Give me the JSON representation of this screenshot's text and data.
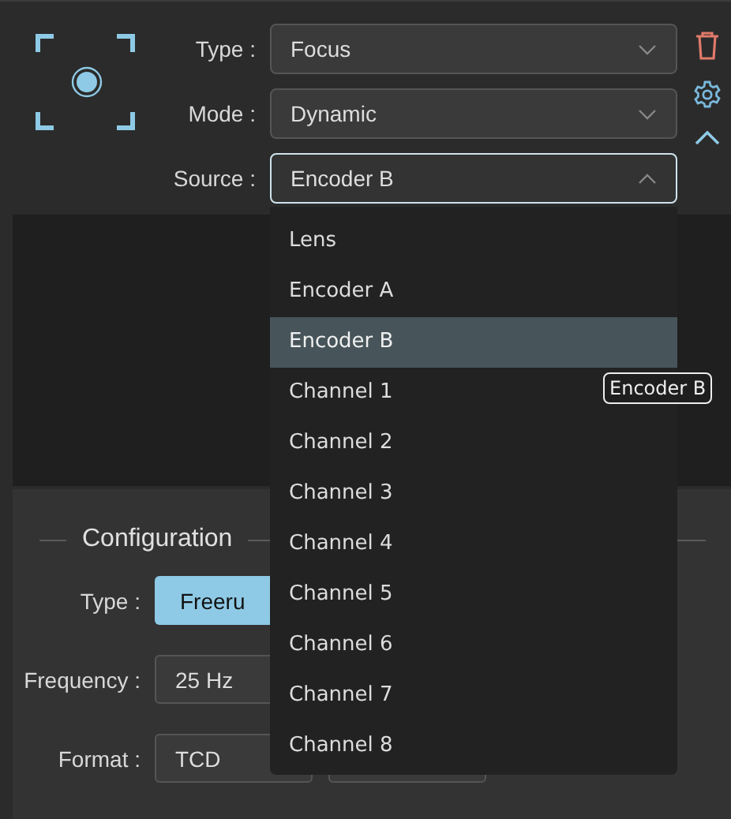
{
  "selectors": [
    {
      "label": "Type :",
      "value": "Focus",
      "open": false
    },
    {
      "label": "Mode :",
      "value": "Dynamic",
      "open": false
    },
    {
      "label": "Source :",
      "value": "Encoder B",
      "open": true
    }
  ],
  "dropdown": {
    "options": [
      {
        "label": "Lens",
        "selected": false
      },
      {
        "label": "Encoder A",
        "selected": false
      },
      {
        "label": "Encoder B",
        "selected": true
      },
      {
        "label": "Channel 1",
        "selected": false
      },
      {
        "label": "Channel 2",
        "selected": false
      },
      {
        "label": "Channel 3",
        "selected": false
      },
      {
        "label": "Channel 4",
        "selected": false
      },
      {
        "label": "Channel 5",
        "selected": false
      },
      {
        "label": "Channel 6",
        "selected": false
      },
      {
        "label": "Channel 7",
        "selected": false
      },
      {
        "label": "Channel 8",
        "selected": false
      }
    ],
    "tooltip": "Encoder B"
  },
  "configuration": {
    "title": "Configuration",
    "rows": [
      {
        "label": "Type :",
        "kind": "button",
        "value": "Freeru"
      },
      {
        "label": "Frequency :",
        "kind": "select",
        "value": "25 Hz"
      },
      {
        "label": "Format :",
        "kind": "pair",
        "value": "TCD"
      }
    ]
  }
}
